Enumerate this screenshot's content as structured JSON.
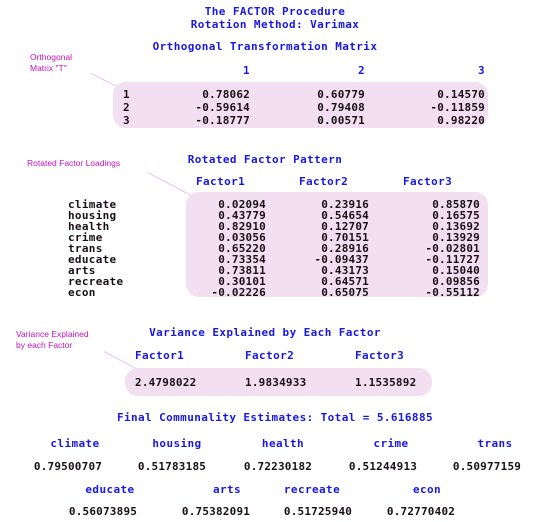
{
  "report": {
    "title_line1": "The FACTOR Procedure",
    "title_line2": "Rotation Method: Varimax"
  },
  "annotations": {
    "orthogonal_matrix": "Orthogonal\nMatrix \"T\"",
    "rotated_loadings": "Rotated Factor Loadings",
    "variance_explained": "Variance Explained\nby each Factor"
  },
  "orthogonal_transformation_matrix": {
    "title": "Orthogonal Transformation Matrix",
    "columns": [
      "1",
      "2",
      "3"
    ],
    "rows": [
      {
        "label": "1",
        "values": [
          "0.78062",
          "0.60779",
          "0.14570"
        ]
      },
      {
        "label": "2",
        "values": [
          "-0.59614",
          "0.79408",
          "-0.11859"
        ]
      },
      {
        "label": "3",
        "values": [
          "-0.18777",
          "0.00571",
          "0.98220"
        ]
      }
    ]
  },
  "rotated_factor_pattern": {
    "title": "Rotated Factor Pattern",
    "columns": [
      "Factor1",
      "Factor2",
      "Factor3"
    ],
    "rows": [
      {
        "label": "climate",
        "values": [
          "0.02094",
          "0.23916",
          "0.85870"
        ]
      },
      {
        "label": "housing",
        "values": [
          "0.43779",
          "0.54654",
          "0.16575"
        ]
      },
      {
        "label": "health",
        "values": [
          "0.82910",
          "0.12707",
          "0.13692"
        ]
      },
      {
        "label": "crime",
        "values": [
          "0.03056",
          "0.70151",
          "0.13929"
        ]
      },
      {
        "label": "trans",
        "values": [
          "0.65220",
          "0.28916",
          "-0.02801"
        ]
      },
      {
        "label": "educate",
        "values": [
          "0.73354",
          "-0.09437",
          "-0.11727"
        ]
      },
      {
        "label": "arts",
        "values": [
          "0.73811",
          "0.43173",
          "0.15040"
        ]
      },
      {
        "label": "recreate",
        "values": [
          "0.30101",
          "0.64571",
          "0.09856"
        ]
      },
      {
        "label": "econ",
        "values": [
          "-0.02226",
          "0.65075",
          "-0.55112"
        ]
      }
    ]
  },
  "variance_explained": {
    "title": "Variance Explained by Each Factor",
    "columns": [
      "Factor1",
      "Factor2",
      "Factor3"
    ],
    "values": [
      "2.4798022",
      "1.9834933",
      "1.1535892"
    ]
  },
  "final_communality": {
    "title": "Final Communality Estimates: Total = 5.616885",
    "row1_labels": [
      "climate",
      "housing",
      "health",
      "crime",
      "trans"
    ],
    "row1_values": [
      "0.79500707",
      "0.51783185",
      "0.72230182",
      "0.51244913",
      "0.50977159"
    ],
    "row2_labels": [
      "educate",
      "arts",
      "recreate",
      "econ"
    ],
    "row2_values": [
      "0.56073895",
      "0.75382091",
      "0.51725940",
      "0.72770402"
    ]
  },
  "chart_data": {
    "type": "table",
    "title": "The FACTOR Procedure - Rotation Method: Varimax",
    "tables": [
      {
        "name": "Orthogonal Transformation Matrix",
        "row_headers": [
          "1",
          "2",
          "3"
        ],
        "col_headers": [
          "1",
          "2",
          "3"
        ],
        "values": [
          [
            0.78062,
            0.60779,
            0.1457
          ],
          [
            -0.59614,
            0.79408,
            -0.11859
          ],
          [
            -0.18777,
            0.00571,
            0.9822
          ]
        ]
      },
      {
        "name": "Rotated Factor Pattern",
        "row_headers": [
          "climate",
          "housing",
          "health",
          "crime",
          "trans",
          "educate",
          "arts",
          "recreate",
          "econ"
        ],
        "col_headers": [
          "Factor1",
          "Factor2",
          "Factor3"
        ],
        "values": [
          [
            0.02094,
            0.23916,
            0.8587
          ],
          [
            0.43779,
            0.54654,
            0.16575
          ],
          [
            0.8291,
            0.12707,
            0.13692
          ],
          [
            0.03056,
            0.70151,
            0.13929
          ],
          [
            0.6522,
            0.28916,
            -0.02801
          ],
          [
            0.73354,
            -0.09437,
            -0.11727
          ],
          [
            0.73811,
            0.43173,
            0.1504
          ],
          [
            0.30101,
            0.64571,
            0.09856
          ],
          [
            -0.02226,
            0.65075,
            -0.55112
          ]
        ]
      },
      {
        "name": "Variance Explained by Each Factor",
        "col_headers": [
          "Factor1",
          "Factor2",
          "Factor3"
        ],
        "values": [
          [
            2.4798022,
            1.9834933,
            1.1535892
          ]
        ]
      },
      {
        "name": "Final Communality Estimates",
        "total": 5.616885,
        "col_headers": [
          "climate",
          "housing",
          "health",
          "crime",
          "trans",
          "educate",
          "arts",
          "recreate",
          "econ"
        ],
        "values": [
          [
            0.79500707,
            0.51783185,
            0.72230182,
            0.51244913,
            0.50977159,
            0.56073895,
            0.75382091,
            0.5172594,
            0.72770402
          ]
        ]
      }
    ]
  }
}
